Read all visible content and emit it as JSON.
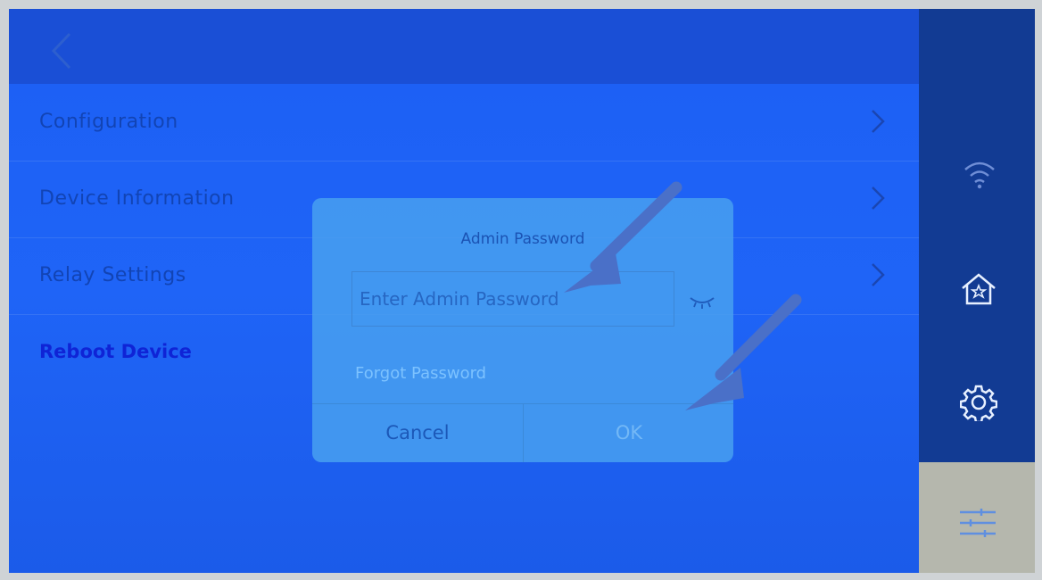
{
  "header": {
    "title": "",
    "back_icon": "chevron-left-icon"
  },
  "menu": [
    {
      "label": "Configuration",
      "icon": "chevron-right-icon"
    },
    {
      "label": "Device Information",
      "icon": "chevron-right-icon"
    },
    {
      "label": "Relay Settings",
      "icon": "chevron-right-icon"
    }
  ],
  "reboot_label": "Reboot Device",
  "sidebar": {
    "icons": [
      "wifi-icon",
      "home-icon",
      "gear-icon",
      "sliders-icon"
    ]
  },
  "dialog": {
    "title": "Admin Password",
    "input_placeholder": "Enter Admin Password",
    "input_value": "",
    "forgot_label": "Forgot Password",
    "cancel_label": "Cancel",
    "ok_label": "OK",
    "eye_icon": "eye-closed-icon"
  },
  "colors": {
    "screen": "#1f5df2",
    "sidebar": "#123b93",
    "annotation_arrow": "#4a70c8"
  }
}
